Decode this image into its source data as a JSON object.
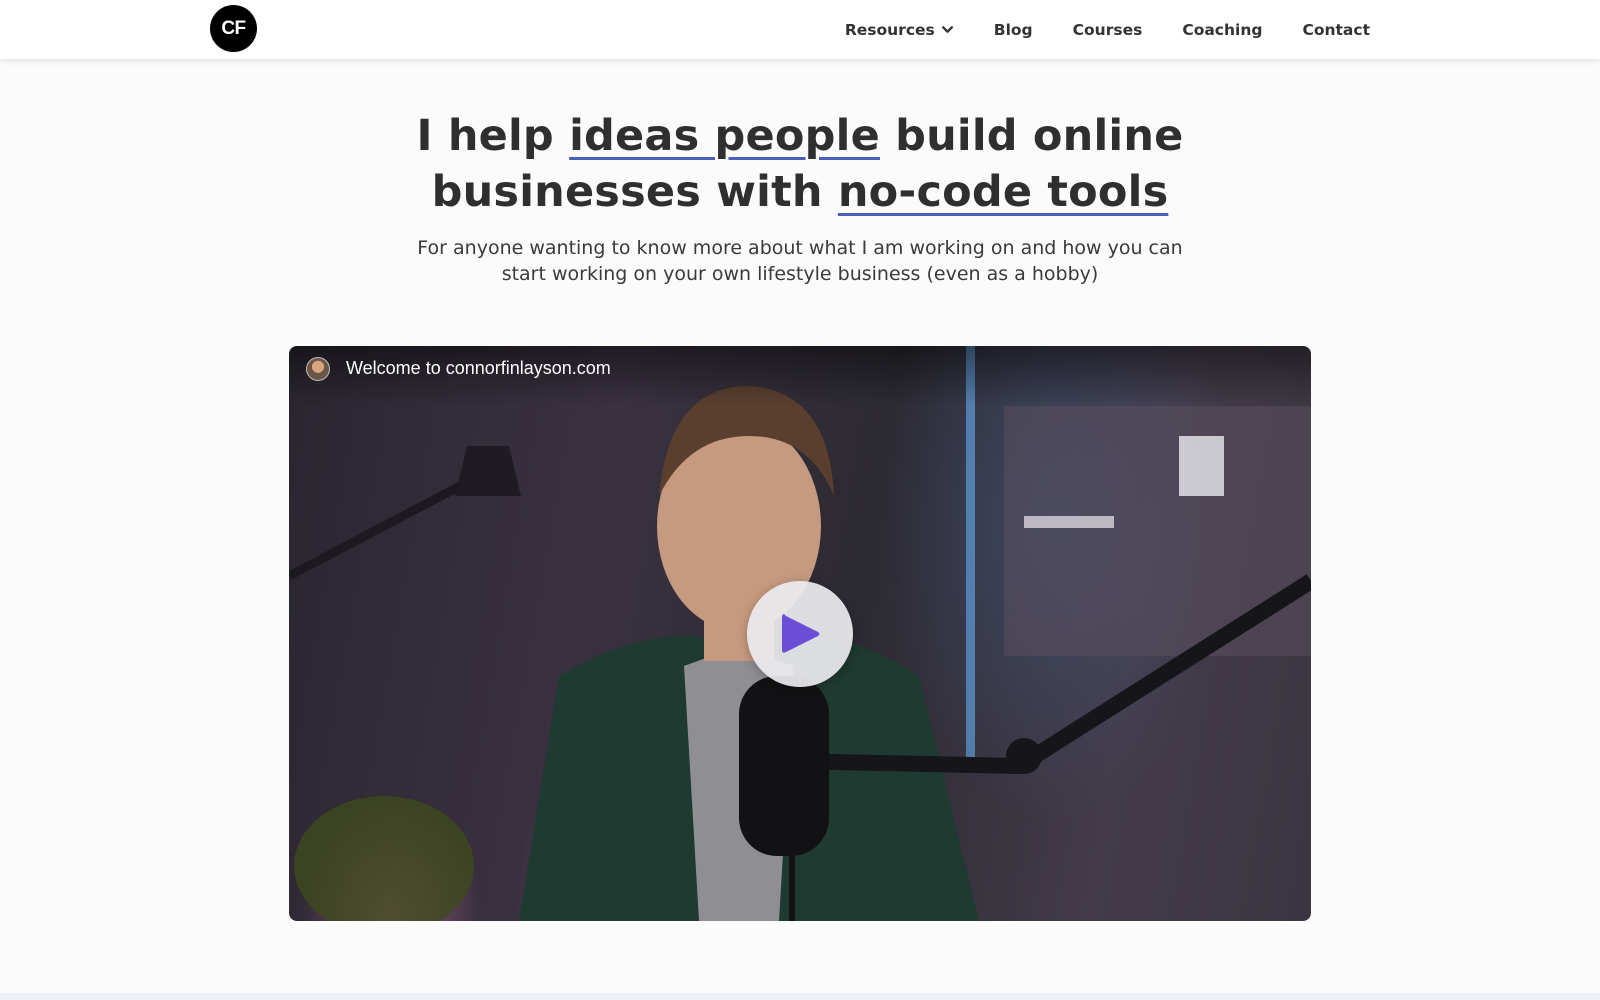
{
  "header": {
    "logo_text": "CF",
    "nav": [
      {
        "label": "Resources",
        "has_dropdown": true
      },
      {
        "label": "Blog"
      },
      {
        "label": "Courses"
      },
      {
        "label": "Coaching"
      },
      {
        "label": "Contact"
      }
    ]
  },
  "hero": {
    "title_line1_pre": "I help ",
    "title_line1_highlight": "ideas people",
    "title_line1_post": " build online",
    "title_line2_pre": "businesses with ",
    "title_line2_highlight": "no-code tools",
    "subtitle": "For anyone wanting to know more about what I am working on and how you can start working on your own lifestyle business (even as a hobby)"
  },
  "video": {
    "title": "Welcome to connorfinlayson.com",
    "play_icon": "play-icon"
  },
  "colors": {
    "underline_accent": "#4c5fb8",
    "play_icon": "#6a4fd6",
    "logo_bg": "#000000"
  }
}
